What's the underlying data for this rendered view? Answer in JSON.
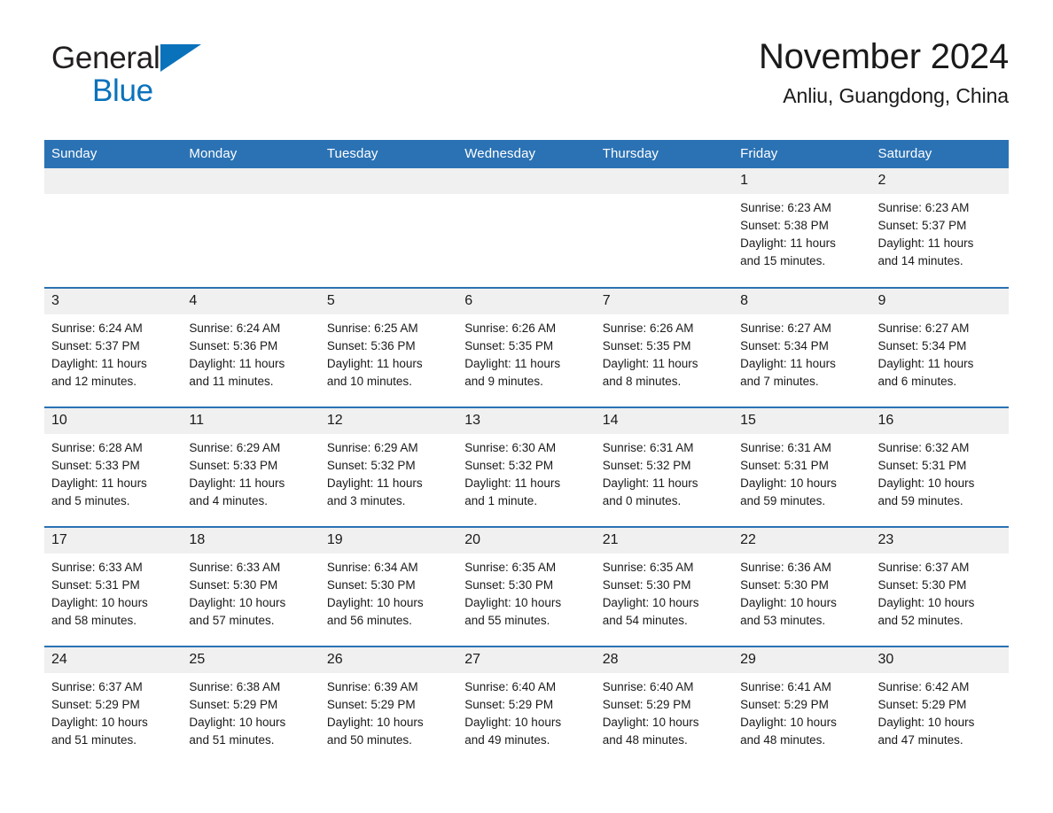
{
  "brand": {
    "word1": "General",
    "word2": "Blue",
    "logo_icon": "triangle-logo-icon",
    "color_dark": "#231f20",
    "color_blue": "#0a72bb"
  },
  "header": {
    "title": "November 2024",
    "subtitle": "Anliu, Guangdong, China"
  },
  "theme": {
    "header_blue": "#2b72b4",
    "daynum_gray": "#f0f0f0",
    "text": "#1a1a1a"
  },
  "calendar": {
    "weekday_headers": [
      "Sunday",
      "Monday",
      "Tuesday",
      "Wednesday",
      "Thursday",
      "Friday",
      "Saturday"
    ],
    "labels": {
      "sunrise": "Sunrise:",
      "sunset": "Sunset:",
      "daylight": "Daylight:"
    },
    "weeks": [
      [
        {
          "day": "",
          "sunrise": "",
          "sunset": "",
          "daylight_a": "",
          "daylight_b": ""
        },
        {
          "day": "",
          "sunrise": "",
          "sunset": "",
          "daylight_a": "",
          "daylight_b": ""
        },
        {
          "day": "",
          "sunrise": "",
          "sunset": "",
          "daylight_a": "",
          "daylight_b": ""
        },
        {
          "day": "",
          "sunrise": "",
          "sunset": "",
          "daylight_a": "",
          "daylight_b": ""
        },
        {
          "day": "",
          "sunrise": "",
          "sunset": "",
          "daylight_a": "",
          "daylight_b": ""
        },
        {
          "day": "1",
          "sunrise": "Sunrise: 6:23 AM",
          "sunset": "Sunset: 5:38 PM",
          "daylight_a": "Daylight: 11 hours",
          "daylight_b": "and 15 minutes."
        },
        {
          "day": "2",
          "sunrise": "Sunrise: 6:23 AM",
          "sunset": "Sunset: 5:37 PM",
          "daylight_a": "Daylight: 11 hours",
          "daylight_b": "and 14 minutes."
        }
      ],
      [
        {
          "day": "3",
          "sunrise": "Sunrise: 6:24 AM",
          "sunset": "Sunset: 5:37 PM",
          "daylight_a": "Daylight: 11 hours",
          "daylight_b": "and 12 minutes."
        },
        {
          "day": "4",
          "sunrise": "Sunrise: 6:24 AM",
          "sunset": "Sunset: 5:36 PM",
          "daylight_a": "Daylight: 11 hours",
          "daylight_b": "and 11 minutes."
        },
        {
          "day": "5",
          "sunrise": "Sunrise: 6:25 AM",
          "sunset": "Sunset: 5:36 PM",
          "daylight_a": "Daylight: 11 hours",
          "daylight_b": "and 10 minutes."
        },
        {
          "day": "6",
          "sunrise": "Sunrise: 6:26 AM",
          "sunset": "Sunset: 5:35 PM",
          "daylight_a": "Daylight: 11 hours",
          "daylight_b": "and 9 minutes."
        },
        {
          "day": "7",
          "sunrise": "Sunrise: 6:26 AM",
          "sunset": "Sunset: 5:35 PM",
          "daylight_a": "Daylight: 11 hours",
          "daylight_b": "and 8 minutes."
        },
        {
          "day": "8",
          "sunrise": "Sunrise: 6:27 AM",
          "sunset": "Sunset: 5:34 PM",
          "daylight_a": "Daylight: 11 hours",
          "daylight_b": "and 7 minutes."
        },
        {
          "day": "9",
          "sunrise": "Sunrise: 6:27 AM",
          "sunset": "Sunset: 5:34 PM",
          "daylight_a": "Daylight: 11 hours",
          "daylight_b": "and 6 minutes."
        }
      ],
      [
        {
          "day": "10",
          "sunrise": "Sunrise: 6:28 AM",
          "sunset": "Sunset: 5:33 PM",
          "daylight_a": "Daylight: 11 hours",
          "daylight_b": "and 5 minutes."
        },
        {
          "day": "11",
          "sunrise": "Sunrise: 6:29 AM",
          "sunset": "Sunset: 5:33 PM",
          "daylight_a": "Daylight: 11 hours",
          "daylight_b": "and 4 minutes."
        },
        {
          "day": "12",
          "sunrise": "Sunrise: 6:29 AM",
          "sunset": "Sunset: 5:32 PM",
          "daylight_a": "Daylight: 11 hours",
          "daylight_b": "and 3 minutes."
        },
        {
          "day": "13",
          "sunrise": "Sunrise: 6:30 AM",
          "sunset": "Sunset: 5:32 PM",
          "daylight_a": "Daylight: 11 hours",
          "daylight_b": "and 1 minute."
        },
        {
          "day": "14",
          "sunrise": "Sunrise: 6:31 AM",
          "sunset": "Sunset: 5:32 PM",
          "daylight_a": "Daylight: 11 hours",
          "daylight_b": "and 0 minutes."
        },
        {
          "day": "15",
          "sunrise": "Sunrise: 6:31 AM",
          "sunset": "Sunset: 5:31 PM",
          "daylight_a": "Daylight: 10 hours",
          "daylight_b": "and 59 minutes."
        },
        {
          "day": "16",
          "sunrise": "Sunrise: 6:32 AM",
          "sunset": "Sunset: 5:31 PM",
          "daylight_a": "Daylight: 10 hours",
          "daylight_b": "and 59 minutes."
        }
      ],
      [
        {
          "day": "17",
          "sunrise": "Sunrise: 6:33 AM",
          "sunset": "Sunset: 5:31 PM",
          "daylight_a": "Daylight: 10 hours",
          "daylight_b": "and 58 minutes."
        },
        {
          "day": "18",
          "sunrise": "Sunrise: 6:33 AM",
          "sunset": "Sunset: 5:30 PM",
          "daylight_a": "Daylight: 10 hours",
          "daylight_b": "and 57 minutes."
        },
        {
          "day": "19",
          "sunrise": "Sunrise: 6:34 AM",
          "sunset": "Sunset: 5:30 PM",
          "daylight_a": "Daylight: 10 hours",
          "daylight_b": "and 56 minutes."
        },
        {
          "day": "20",
          "sunrise": "Sunrise: 6:35 AM",
          "sunset": "Sunset: 5:30 PM",
          "daylight_a": "Daylight: 10 hours",
          "daylight_b": "and 55 minutes."
        },
        {
          "day": "21",
          "sunrise": "Sunrise: 6:35 AM",
          "sunset": "Sunset: 5:30 PM",
          "daylight_a": "Daylight: 10 hours",
          "daylight_b": "and 54 minutes."
        },
        {
          "day": "22",
          "sunrise": "Sunrise: 6:36 AM",
          "sunset": "Sunset: 5:30 PM",
          "daylight_a": "Daylight: 10 hours",
          "daylight_b": "and 53 minutes."
        },
        {
          "day": "23",
          "sunrise": "Sunrise: 6:37 AM",
          "sunset": "Sunset: 5:30 PM",
          "daylight_a": "Daylight: 10 hours",
          "daylight_b": "and 52 minutes."
        }
      ],
      [
        {
          "day": "24",
          "sunrise": "Sunrise: 6:37 AM",
          "sunset": "Sunset: 5:29 PM",
          "daylight_a": "Daylight: 10 hours",
          "daylight_b": "and 51 minutes."
        },
        {
          "day": "25",
          "sunrise": "Sunrise: 6:38 AM",
          "sunset": "Sunset: 5:29 PM",
          "daylight_a": "Daylight: 10 hours",
          "daylight_b": "and 51 minutes."
        },
        {
          "day": "26",
          "sunrise": "Sunrise: 6:39 AM",
          "sunset": "Sunset: 5:29 PM",
          "daylight_a": "Daylight: 10 hours",
          "daylight_b": "and 50 minutes."
        },
        {
          "day": "27",
          "sunrise": "Sunrise: 6:40 AM",
          "sunset": "Sunset: 5:29 PM",
          "daylight_a": "Daylight: 10 hours",
          "daylight_b": "and 49 minutes."
        },
        {
          "day": "28",
          "sunrise": "Sunrise: 6:40 AM",
          "sunset": "Sunset: 5:29 PM",
          "daylight_a": "Daylight: 10 hours",
          "daylight_b": "and 48 minutes."
        },
        {
          "day": "29",
          "sunrise": "Sunrise: 6:41 AM",
          "sunset": "Sunset: 5:29 PM",
          "daylight_a": "Daylight: 10 hours",
          "daylight_b": "and 48 minutes."
        },
        {
          "day": "30",
          "sunrise": "Sunrise: 6:42 AM",
          "sunset": "Sunset: 5:29 PM",
          "daylight_a": "Daylight: 10 hours",
          "daylight_b": "and 47 minutes."
        }
      ]
    ]
  }
}
